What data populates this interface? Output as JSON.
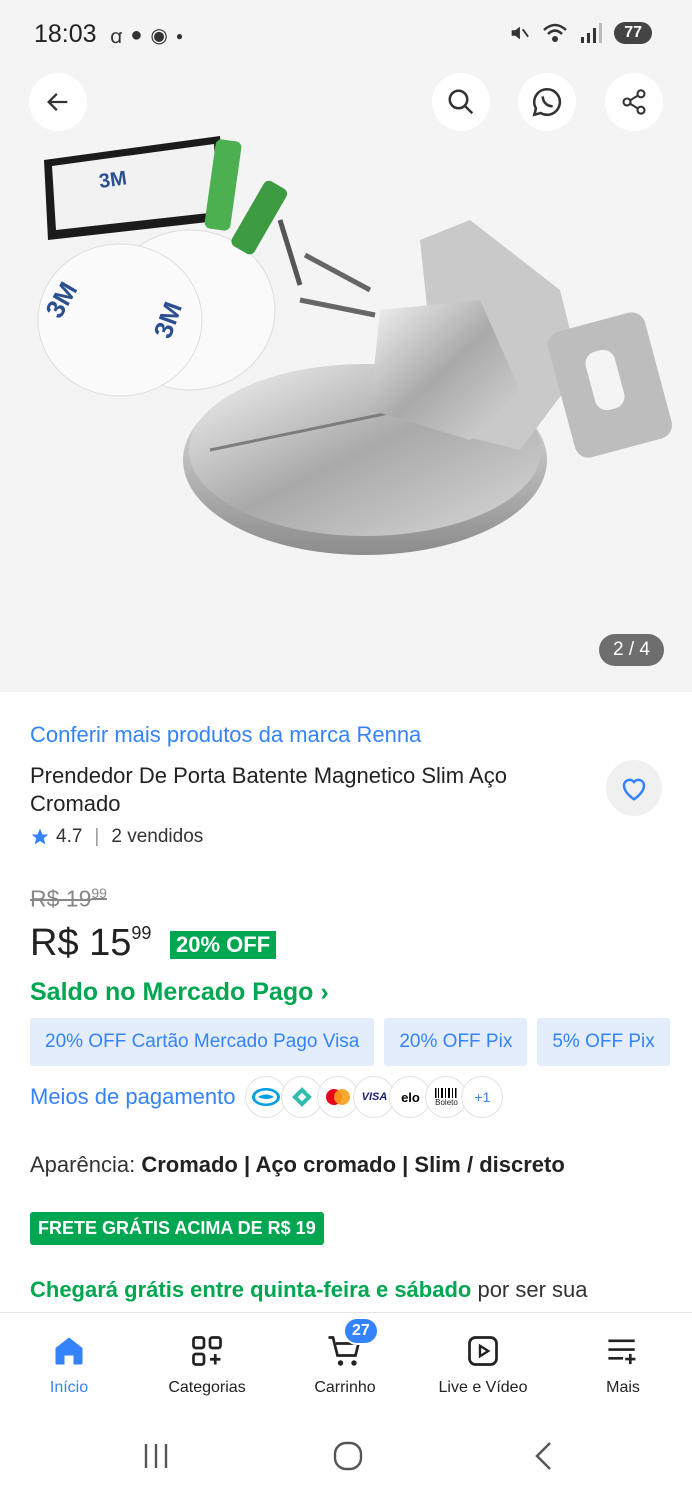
{
  "status": {
    "time": "18:03",
    "battery": "77",
    "signal_label": "5"
  },
  "gallery": {
    "counter": "2 / 4"
  },
  "product": {
    "brand_link": "Conferir mais produtos da marca Renna",
    "title": "Prendedor De Porta Batente Magnetico Slim Aço Cromado",
    "rating": "4.7",
    "sold": "2 vendidos",
    "old_price_int": "R$ 19",
    "old_price_cents": "99",
    "price_int": "R$ 15",
    "price_cents": "99",
    "discount": "20% OFF",
    "saldo": "Saldo no Mercado Pago ›"
  },
  "promos": [
    "20% OFF Cartão Mercado Pago Visa",
    "20% OFF Pix",
    "5% OFF Pix"
  ],
  "payments": {
    "label": "Meios de pagamento",
    "icons": [
      "mercadopago-icon",
      "pix-icon",
      "mastercard-icon",
      "visa-icon",
      "elo-icon",
      "boleto-icon"
    ],
    "visa": "VISA",
    "elo": "elo",
    "boleto": "Boleto",
    "more": "+1"
  },
  "appearance": {
    "label": "Aparência:",
    "values": "Cromado | Aço cromado | Slim / discreto"
  },
  "shipping": {
    "badge": "FRETE GRÁTIS ACIMA DE R$ 19",
    "arrival_green": "Chegará grátis entre quinta-feira e sábado",
    "arrival_rest": " por ser sua"
  },
  "tabs": [
    {
      "label": "Início",
      "icon": "home-icon",
      "active": true
    },
    {
      "label": "Categorias",
      "icon": "categories-icon"
    },
    {
      "label": "Carrinho",
      "icon": "cart-icon",
      "badge": "27"
    },
    {
      "label": "Live e Vídeo",
      "icon": "play-icon"
    },
    {
      "label": "Mais",
      "icon": "more-icon"
    }
  ],
  "colors": {
    "accent": "#3483fa",
    "green": "#00a650"
  }
}
